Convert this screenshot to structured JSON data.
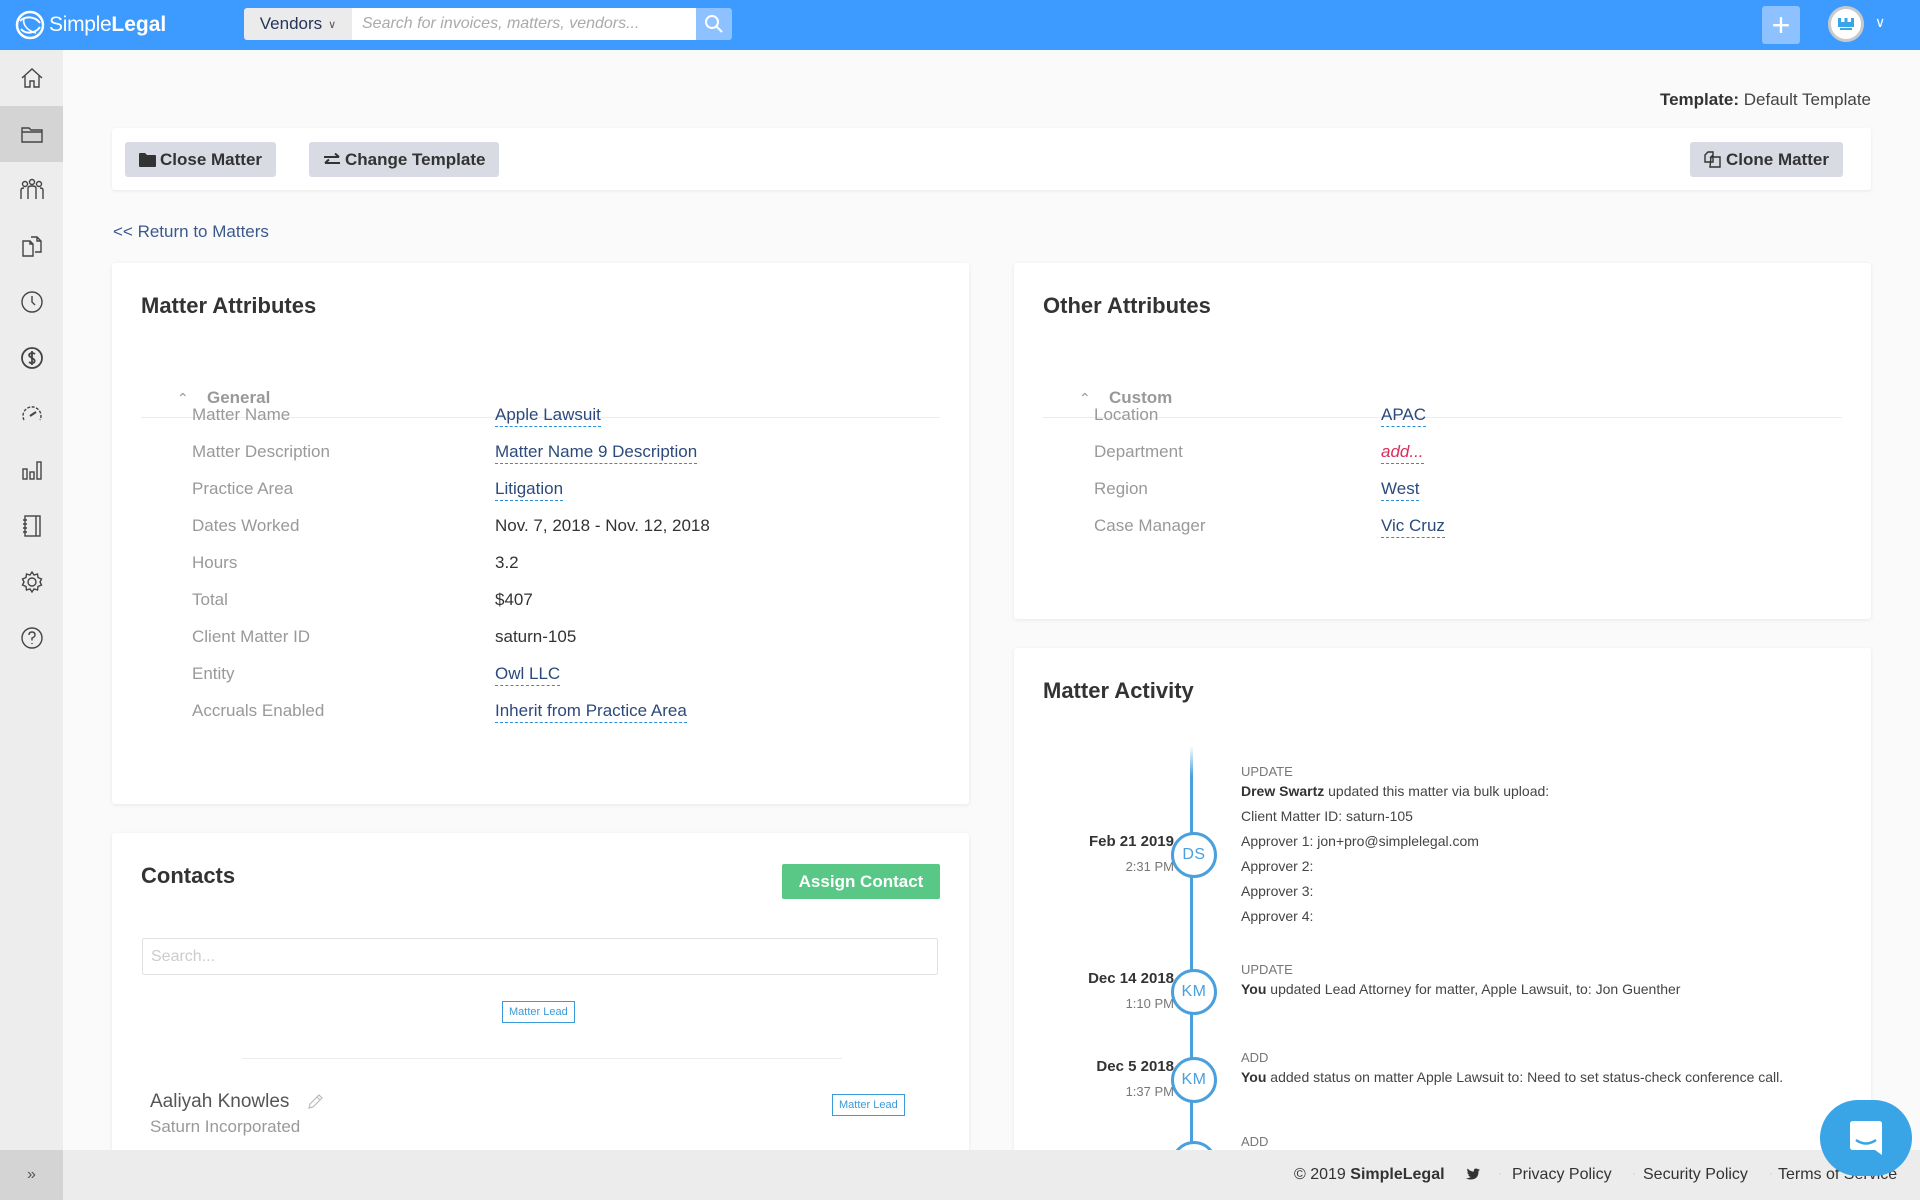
{
  "topbar": {
    "brand_light": "Simple",
    "brand_bold": "Legal",
    "search_category": "Vendors",
    "search_placeholder": "Search for invoices, matters, vendors...",
    "search_value": "",
    "icons": {
      "search": "search-icon",
      "add": "plus-icon",
      "user": "user-avatar",
      "menu": "chevron-down-icon"
    }
  },
  "sidebar": {
    "items": [
      {
        "name": "home",
        "icon": "home-icon",
        "active": false
      },
      {
        "name": "matters",
        "icon": "folder-icon",
        "active": true
      },
      {
        "name": "vendors",
        "icon": "people-icon",
        "active": false
      },
      {
        "name": "invoices",
        "icon": "documents-icon",
        "active": false
      },
      {
        "name": "timekeeping",
        "icon": "clock-icon",
        "active": false
      },
      {
        "name": "budgets",
        "icon": "dollar-icon",
        "active": false
      },
      {
        "name": "dashboard",
        "icon": "gauge-icon",
        "active": false
      },
      {
        "name": "reports",
        "icon": "bar-chart-icon",
        "active": false
      },
      {
        "name": "notebook",
        "icon": "notebook-icon",
        "active": false
      },
      {
        "name": "settings",
        "icon": "gear-icon",
        "active": false
      },
      {
        "name": "help",
        "icon": "help-icon",
        "active": false
      }
    ],
    "expand_label": "»"
  },
  "page": {
    "template_label": "Template:",
    "template_value": "Default Template",
    "close_matter": "Close Matter",
    "change_template": "Change Template",
    "clone_matter": "Clone Matter",
    "return_link": "<< Return to Matters"
  },
  "matter_attributes": {
    "title": "Matter Attributes",
    "section": "General",
    "rows": [
      {
        "label": "Matter Name",
        "value": "Apple Lawsuit",
        "editable": true
      },
      {
        "label": "Matter Description",
        "value": "Matter Name 9 Description",
        "editable": true
      },
      {
        "label": "Practice Area",
        "value": "Litigation",
        "editable": true
      },
      {
        "label": "Dates Worked",
        "value": "Nov. 7, 2018 - Nov. 12, 2018",
        "editable": false
      },
      {
        "label": "Hours",
        "value": "3.2",
        "editable": false
      },
      {
        "label": "Total",
        "value": "$407",
        "editable": false
      },
      {
        "label": "Client Matter ID",
        "value": "saturn-105",
        "editable": false
      },
      {
        "label": "Entity",
        "value": "Owl LLC",
        "editable": true
      },
      {
        "label": "Accruals Enabled",
        "value": "Inherit from Practice Area",
        "editable": true
      }
    ]
  },
  "other_attributes": {
    "title": "Other Attributes",
    "section": "Custom",
    "rows": [
      {
        "label": "Location",
        "value": "APAC",
        "empty": false
      },
      {
        "label": "Department",
        "value": "add...",
        "empty": true
      },
      {
        "label": "Region",
        "value": "West",
        "empty": false
      },
      {
        "label": "Case Manager",
        "value": "Vic Cruz",
        "empty": false
      }
    ]
  },
  "contacts": {
    "title": "Contacts",
    "assign_button": "Assign Contact",
    "search_placeholder": "Search...",
    "search_value": "",
    "filter_tag": "Matter Lead",
    "items": [
      {
        "name": "Aaliyah Knowles",
        "company": "Saturn Incorporated",
        "role": "Matter Lead"
      }
    ]
  },
  "activity": {
    "title": "Matter Activity",
    "entries": [
      {
        "date": "Feb 21 2019",
        "time": "2:31 PM",
        "initials": "DS",
        "type": "UPDATE",
        "actor": "Drew Swartz",
        "text": " updated this matter via bulk upload:",
        "details": [
          "Client Matter ID: saturn-105",
          "Approver 1: jon+pro@simplelegal.com",
          "Approver 2:",
          "Approver 3:",
          "Approver 4:"
        ]
      },
      {
        "date": "Dec 14 2018",
        "time": "1:10 PM",
        "initials": "KM",
        "type": "UPDATE",
        "actor": "You",
        "text": " updated Lead Attorney for matter, Apple Lawsuit, to: Jon Guenther",
        "details": []
      },
      {
        "date": "Dec 5 2018",
        "time": "1:37 PM",
        "initials": "KM",
        "type": "ADD",
        "actor": "You",
        "text": " added status on matter Apple Lawsuit to: Need to set status-check conference call.",
        "details": []
      },
      {
        "date": "",
        "time": "",
        "initials": "",
        "type": "ADD",
        "actor": "",
        "text": "",
        "details": []
      }
    ]
  },
  "footer": {
    "copyright": "© 2019",
    "brand": "SimpleLegal",
    "links": [
      "Privacy Policy",
      "Security Policy",
      "Terms of Service"
    ]
  },
  "colors": {
    "brand_blue": "#3d9bff",
    "link": "#2c4a7c",
    "accent_green": "#59c785",
    "timeline_blue": "#4a9fdd",
    "empty_red": "#d92e5a"
  }
}
